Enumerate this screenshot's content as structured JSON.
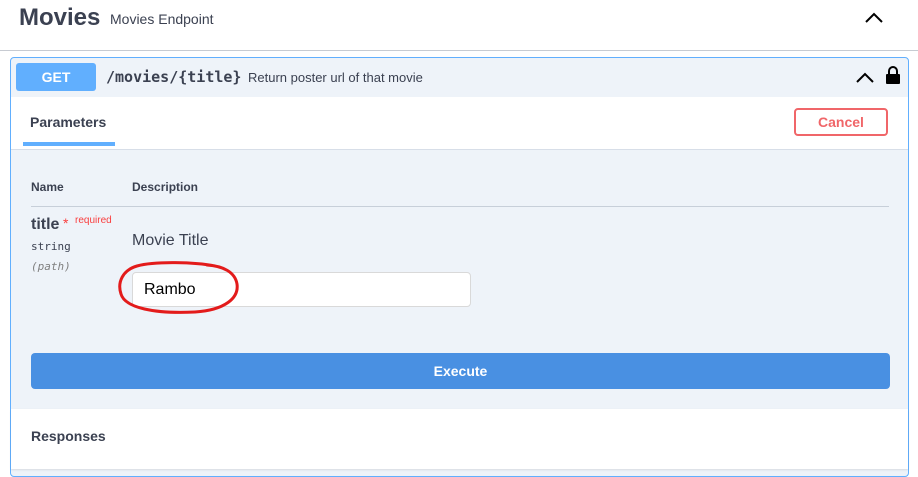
{
  "tag": {
    "title": "Movies",
    "description": "Movies Endpoint",
    "toggle_icon": "chevron-up-icon"
  },
  "operation": {
    "method": "GET",
    "path": "/movies/{title}",
    "summary": "Return poster url of that movie",
    "collapse_icon": "chevron-up-icon",
    "lock_icon": "lock-icon",
    "colors": {
      "method": "#61affe",
      "background": "#eef3f9"
    }
  },
  "parameters": {
    "tab_label": "Parameters",
    "cancel_label": "Cancel",
    "columns": {
      "name": "Name",
      "description": "Description"
    },
    "items": [
      {
        "name": "title",
        "required_mark": "*",
        "required_label": "required",
        "type": "string",
        "in": "(path)",
        "description": "Movie Title",
        "value": "Rambo"
      }
    ],
    "execute_label": "Execute",
    "execute_color": "#4990e2"
  },
  "responses": {
    "label": "Responses"
  },
  "annotation": {
    "color": "#e31b1b"
  }
}
